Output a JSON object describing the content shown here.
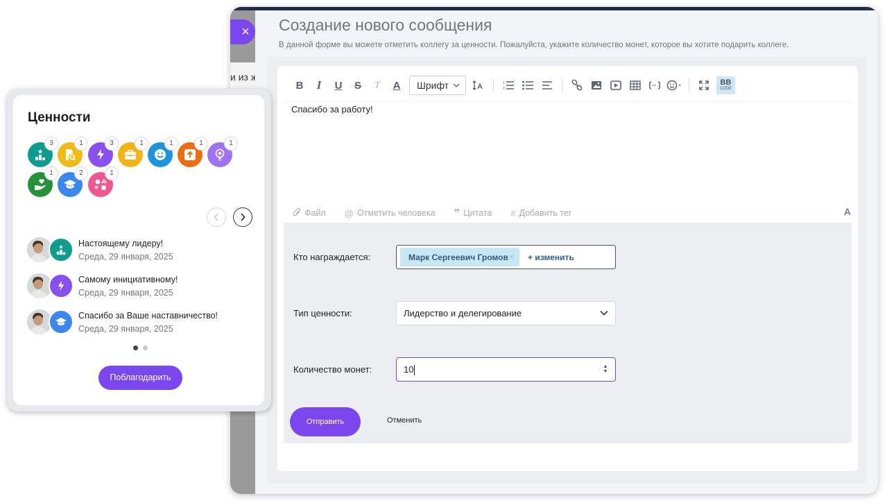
{
  "modal": {
    "close_label": "×",
    "background_fragment": "и из ж",
    "title": "Создание нового сообщения",
    "subtitle": "В данной форме вы можете отметить коллегу за ценности. Пожалуйста, укажите количество монет, которое вы хотите подарить коллеге."
  },
  "toolbar": {
    "bold": "B",
    "italic": "I",
    "underline": "U",
    "strike": "S",
    "clear": "T",
    "font_color": "A",
    "font_select": "Шрифт",
    "font_size": "↕A",
    "bb_code": "BB",
    "bb_code_sub": "CODE"
  },
  "editor": {
    "text": "Спасибо за работу!"
  },
  "attachments": {
    "file": "Файл",
    "mention": "Отметить человека",
    "quote": "Цитата",
    "tag": "Добавить тег",
    "format": "A"
  },
  "form": {
    "recipient_label": "Кто награждается:",
    "recipient_name": "Марк Сергеевич Громов",
    "recipient_remove": "×",
    "change_label": "+ изменить",
    "value_type_label": "Тип ценности:",
    "value_type_selected": "Лидерство и делегирование",
    "coins_label": "Количество монет:",
    "coins_value": "10",
    "send_label": "Отправить",
    "cancel_label": "Отменить"
  },
  "values_widget": {
    "title": "Ценности",
    "badges": [
      {
        "icon": "podium-icon",
        "color": "#0e9c8e",
        "count": "3"
      },
      {
        "icon": "document-search-icon",
        "color": "#f0bb17",
        "count": "1"
      },
      {
        "icon": "lightning-icon",
        "color": "#8850ef",
        "count": "3"
      },
      {
        "icon": "briefcase-icon",
        "color": "#f0b416",
        "count": "1"
      },
      {
        "icon": "smile-icon",
        "color": "#1e94dc",
        "count": "1"
      },
      {
        "icon": "arrow-up-icon",
        "color": "#ec6e12",
        "count": "1"
      },
      {
        "icon": "lightbulb-icon",
        "color": "#a074f0",
        "count": "1"
      },
      {
        "icon": "hand-heart-icon",
        "color": "#27913a",
        "count": "1"
      },
      {
        "icon": "graduation-cap-icon",
        "color": "#3d86ee",
        "count": "2"
      },
      {
        "icon": "shapes-icon",
        "color": "#ef5793",
        "count": "1"
      }
    ],
    "feed": [
      {
        "title": "Настоящему лидеру!",
        "date": "Среда, 29 января, 2025",
        "badge_color": "#0e9c8e"
      },
      {
        "title": "Самому инициативному!",
        "date": "Среда, 29 января, 2025",
        "badge_color": "#8850ef"
      },
      {
        "title": "Спасибо за Ваше наставничество!",
        "date": "Среда, 29 января, 2025",
        "badge_color": "#3d86ee"
      }
    ],
    "thank_button": "Поблагодарить"
  },
  "colors": {
    "accent": "#7b46ee",
    "chip_bg": "#c8e7f5"
  }
}
